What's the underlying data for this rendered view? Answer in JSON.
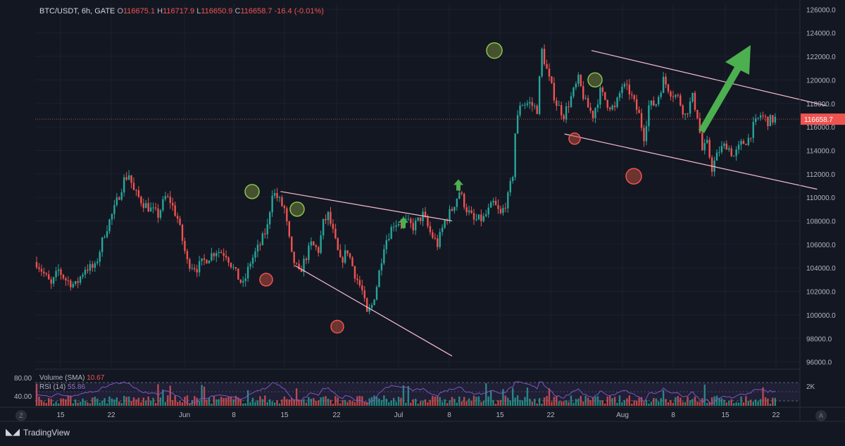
{
  "legend": {
    "symbol": "BTC/USDT, 6h, GATE",
    "o_label": "O",
    "o_value": "116675.1",
    "h_label": "H",
    "h_value": "116717.9",
    "l_label": "L",
    "l_value": "116650.9",
    "c_label": "C",
    "c_value": "116658.7",
    "change": "-16.4 (-0.01%)"
  },
  "brand": "TradingView",
  "buttons": {
    "zoom": "Z",
    "auto": "A"
  },
  "last_price": "116658.7",
  "colors": {
    "up": "#26a69a",
    "down": "#ef5350",
    "background": "#131722",
    "arrow": "#4caf50",
    "rsi": "#7e57c2",
    "trendline": "#f8bbd0"
  },
  "chart_data": [
    {
      "type": "candlestick",
      "x_ticks": [
        "15",
        "22",
        "Jun",
        "8",
        "15",
        "22",
        "Jul",
        "8",
        "15",
        "22",
        "Aug",
        "8",
        "15",
        "22"
      ],
      "y_ticks": [
        "96000.0",
        "98000.0",
        "100000.0",
        "102000.0",
        "104000.0",
        "106000.0",
        "108000.0",
        "110000.0",
        "112000.0",
        "114000.0",
        "116000.0",
        "118000.0",
        "120000.0",
        "122000.0",
        "124000.0",
        "126000.0"
      ],
      "ylim": [
        95500,
        126500
      ],
      "price_path": [
        [
          0,
          104500
        ],
        [
          3,
          103500
        ],
        [
          6,
          102500
        ],
        [
          9,
          103800
        ],
        [
          12,
          103000
        ],
        [
          16,
          102500
        ],
        [
          20,
          104000
        ],
        [
          24,
          104000
        ],
        [
          28,
          107000
        ],
        [
          32,
          109000
        ],
        [
          36,
          111500
        ],
        [
          38,
          112000
        ],
        [
          40,
          110500
        ],
        [
          44,
          109500
        ],
        [
          48,
          108800
        ],
        [
          50,
          108500
        ],
        [
          53,
          110000
        ],
        [
          55,
          109700
        ],
        [
          58,
          108200
        ],
        [
          62,
          104500
        ],
        [
          66,
          104000
        ],
        [
          70,
          104800
        ],
        [
          74,
          105500
        ],
        [
          78,
          105200
        ],
        [
          82,
          103500
        ],
        [
          85,
          102500
        ],
        [
          88,
          104500
        ],
        [
          92,
          106000
        ],
        [
          95,
          107500
        ],
        [
          97,
          110500
        ],
        [
          99,
          110000
        ],
        [
          102,
          109000
        ],
        [
          105,
          105000
        ],
        [
          108,
          103500
        ],
        [
          110,
          104500
        ],
        [
          113,
          106000
        ],
        [
          116,
          105500
        ],
        [
          118,
          107800
        ],
        [
          120,
          108500
        ],
        [
          122,
          107000
        ],
        [
          125,
          104500
        ],
        [
          128,
          105500
        ],
        [
          131,
          103500
        ],
        [
          134,
          102000
        ],
        [
          136,
          100000
        ],
        [
          138,
          100800
        ],
        [
          140,
          102500
        ],
        [
          143,
          106000
        ],
        [
          147,
          107800
        ],
        [
          151,
          108000
        ],
        [
          155,
          107500
        ],
        [
          159,
          108500
        ],
        [
          162,
          107000
        ],
        [
          165,
          106000
        ],
        [
          168,
          108000
        ],
        [
          171,
          109000
        ],
        [
          174,
          110500
        ],
        [
          177,
          109000
        ],
        [
          180,
          108000
        ],
        [
          184,
          108200
        ],
        [
          188,
          109500
        ],
        [
          191,
          108500
        ],
        [
          194,
          110000
        ],
        [
          196,
          112000
        ],
        [
          197,
          115500
        ],
        [
          199,
          118000
        ],
        [
          203,
          118000
        ],
        [
          206,
          117500
        ],
        [
          208,
          122500
        ],
        [
          211,
          120000
        ],
        [
          214,
          118000
        ],
        [
          217,
          117000
        ],
        [
          220,
          118500
        ],
        [
          223,
          120000
        ],
        [
          226,
          118000
        ],
        [
          229,
          117000
        ],
        [
          232,
          119000
        ],
        [
          235,
          118000
        ],
        [
          238,
          117500
        ],
        [
          241,
          119500
        ],
        [
          244,
          119000
        ],
        [
          246,
          118000
        ],
        [
          248,
          117000
        ],
        [
          250,
          115200
        ],
        [
          252,
          117800
        ],
        [
          255,
          118000
        ],
        [
          258,
          120000
        ],
        [
          261,
          119000
        ],
        [
          264,
          118500
        ],
        [
          267,
          117000
        ],
        [
          270,
          118500
        ],
        [
          272,
          117000
        ],
        [
          274,
          114000
        ],
        [
          276,
          114500
        ],
        [
          278,
          112500
        ],
        [
          281,
          114000
        ],
        [
          284,
          114500
        ],
        [
          287,
          113500
        ],
        [
          290,
          114500
        ],
        [
          293,
          115000
        ],
        [
          295,
          116000
        ],
        [
          298,
          117000
        ],
        [
          301,
          116500
        ],
        [
          304,
          116700
        ]
      ],
      "volume_label": "Volume (SMA)",
      "volume_value": "10.67",
      "volume_axis_tick": "2K",
      "rsi_label": "RSI (14)",
      "rsi_value": "55.86",
      "rsi_levels": [
        "80.00",
        "40.00"
      ]
    }
  ],
  "annotations": {
    "green_circle_prices": [
      110500,
      109000,
      122500,
      120000
    ],
    "red_circle_prices": [
      103000,
      99000,
      115000,
      111800
    ],
    "arrow_prices": [
      107800,
      111000
    ]
  }
}
